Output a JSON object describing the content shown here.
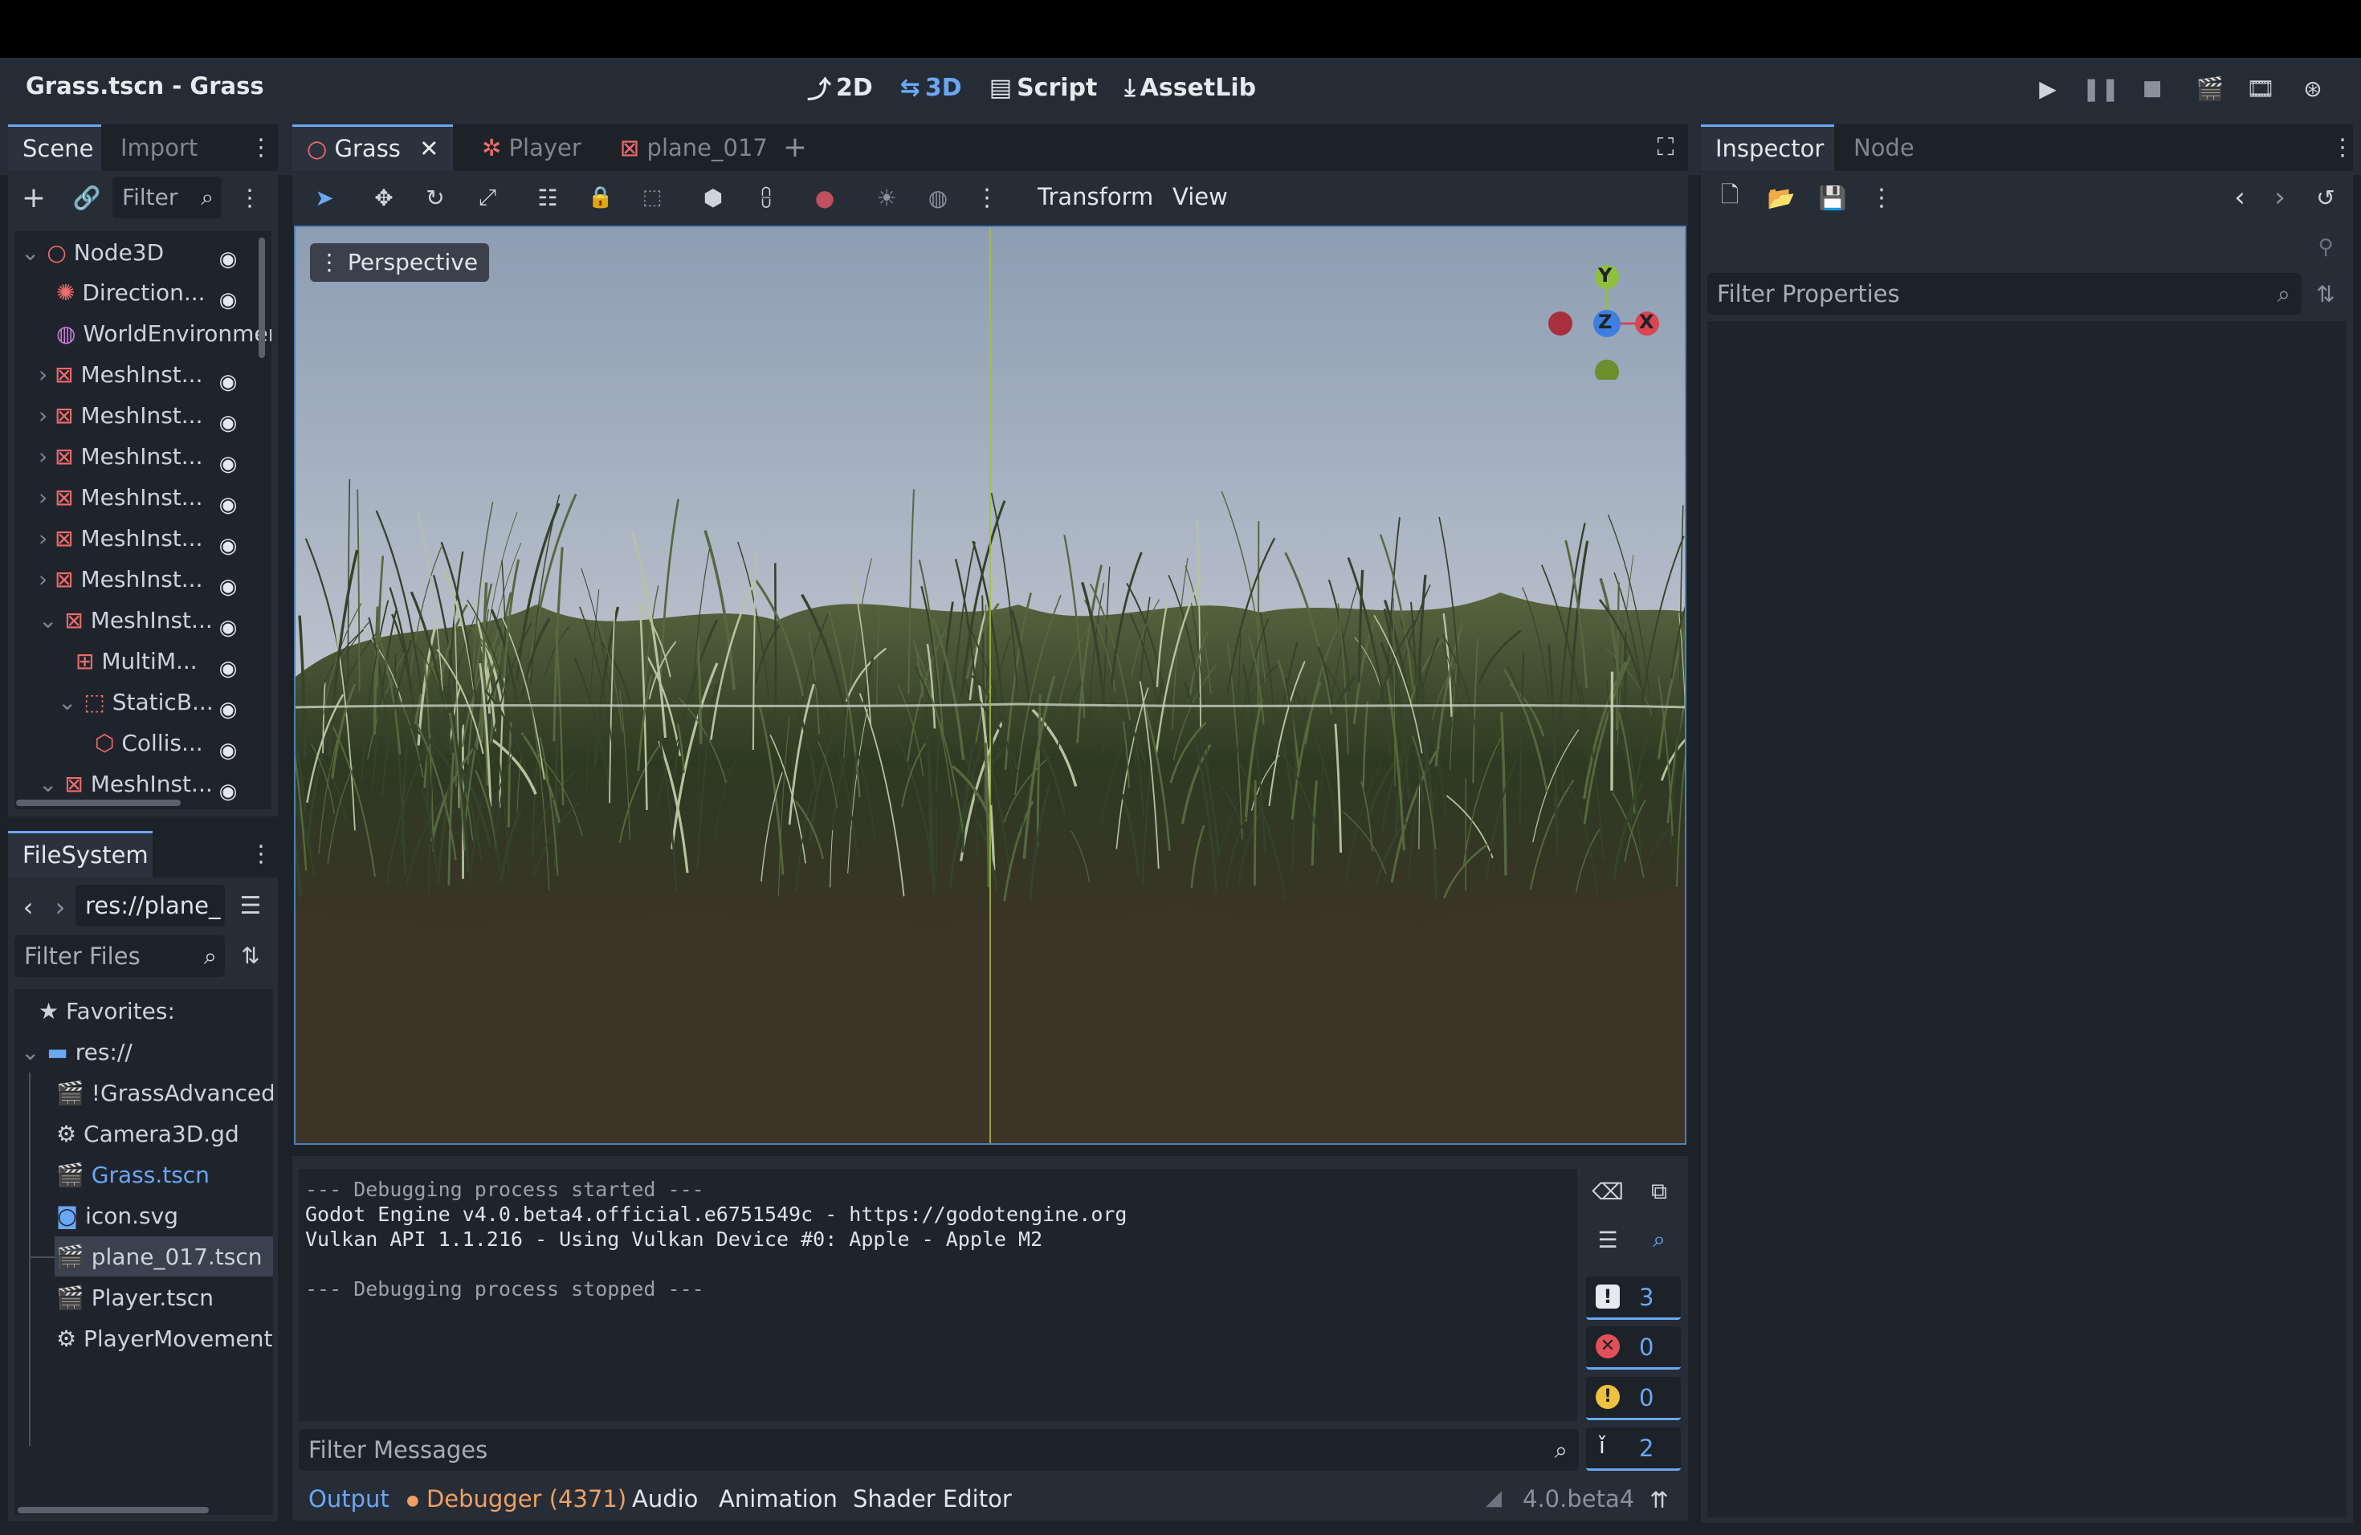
{
  "window": {
    "title": "Grass.tscn - Grass"
  },
  "workspace_tabs": [
    {
      "label": "2D",
      "icon": "2d-icon"
    },
    {
      "label": "3D",
      "icon": "3d-icon"
    },
    {
      "label": "Script",
      "icon": "script-icon"
    },
    {
      "label": "AssetLib",
      "icon": "assetlib-icon"
    }
  ],
  "scene_dock": {
    "tabs": [
      "Scene",
      "Import"
    ],
    "filter_placeholder": "Filter",
    "tree": [
      {
        "label": "Node3D",
        "icon": "node3d-icon"
      },
      {
        "label": "Direction...",
        "icon": "light-icon"
      },
      {
        "label": "WorldEnvironment",
        "icon": "world-icon"
      },
      {
        "label": "MeshInst...",
        "icon": "mesh-icon"
      },
      {
        "label": "MeshInst...",
        "icon": "mesh-icon"
      },
      {
        "label": "MeshInst...",
        "icon": "mesh-icon"
      },
      {
        "label": "MeshInst...",
        "icon": "mesh-icon"
      },
      {
        "label": "MeshInst...",
        "icon": "mesh-icon"
      },
      {
        "label": "MeshInst...",
        "icon": "mesh-icon"
      },
      {
        "label": "MeshInst...",
        "icon": "mesh-icon"
      },
      {
        "label": "MultiM...",
        "icon": "multimesh-icon"
      },
      {
        "label": "StaticB...",
        "icon": "staticbody-icon"
      },
      {
        "label": "Collis...",
        "icon": "collision-icon"
      },
      {
        "label": "MeshInst...",
        "icon": "mesh-icon"
      }
    ]
  },
  "filesystem": {
    "tab": "FileSystem",
    "path": "res://plane_",
    "filter_placeholder": "Filter Files",
    "favorites": "Favorites:",
    "root": "res://",
    "files": [
      {
        "name": "!GrassAdvanced.gd",
        "icon": "scene-icon"
      },
      {
        "name": "Camera3D.gd",
        "icon": "gear-icon"
      },
      {
        "name": "Grass.tscn",
        "icon": "scene-icon"
      },
      {
        "name": "icon.svg",
        "icon": "godot-icon"
      },
      {
        "name": "plane_017.tscn",
        "icon": "scene-icon"
      },
      {
        "name": "Player.tscn",
        "icon": "scene-icon"
      },
      {
        "name": "PlayerMovement",
        "icon": "gear-icon"
      }
    ]
  },
  "editor_tabs": [
    {
      "label": "Grass",
      "icon": "node3d-icon"
    },
    {
      "label": "Player",
      "icon": "player-icon"
    },
    {
      "label": "plane_017",
      "icon": "mesh-icon"
    }
  ],
  "viewport": {
    "toolbar_menus": [
      "Transform",
      "View"
    ],
    "perspective_label": "Perspective",
    "gizmo": {
      "y": "Y",
      "z": "Z",
      "x": "X"
    }
  },
  "output": {
    "lines": [
      "--- Debugging process started ---",
      "Godot Engine v4.0.beta4.official.e6751549c - https://godotengine.org",
      "Vulkan API 1.1.216 - Using Vulkan Device #0: Apple - Apple M2",
      "",
      "--- Debugging process stopped ---"
    ],
    "filter_placeholder": "Filter Messages",
    "counts": {
      "messages": "3",
      "errors": "0",
      "warnings": "0",
      "editor": "2"
    }
  },
  "bottom_tabs": [
    "Output",
    "Debugger (4371)",
    "Audio",
    "Animation",
    "Shader Editor"
  ],
  "version": "4.0.beta4",
  "inspector": {
    "tabs": [
      "Inspector",
      "Node"
    ],
    "filter_placeholder": "Filter Properties"
  },
  "colors": {
    "accent": "#6aa7f5",
    "node_red": "#f06b6b",
    "debugger_orange": "#f0a060"
  }
}
